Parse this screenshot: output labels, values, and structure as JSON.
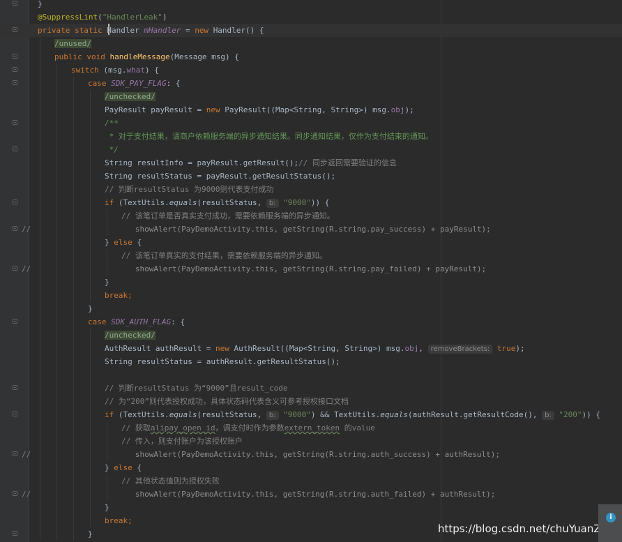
{
  "editor": {
    "lines": [
      {
        "indent": 2,
        "fold": true,
        "tokens": [
          [
            "}",
            ""
          ]
        ]
      },
      {
        "indent": 2,
        "tokens": [
          [
            "@SuppressLint",
            "an"
          ],
          [
            "(",
            ""
          ],
          [
            "\"HandlerLeak\"",
            "str"
          ],
          [
            ")",
            ""
          ]
        ]
      },
      {
        "indent": 2,
        "fold": true,
        "current": true,
        "tokens": [
          [
            "private static ",
            "kw"
          ],
          [
            "Handler ",
            ""
          ],
          [
            "mHandler",
            "fld"
          ],
          [
            " = ",
            ""
          ],
          [
            "new ",
            "kw"
          ],
          [
            "Handler",
            ""
          ],
          [
            "() {",
            ""
          ]
        ]
      },
      {
        "indent": 3,
        "tokens": [
          [
            "/unused/",
            "sup"
          ]
        ]
      },
      {
        "indent": 3,
        "fold": true,
        "tokens": [
          [
            "public void ",
            "kw"
          ],
          [
            "handleMessage",
            "mth"
          ],
          [
            "(Message msg) {",
            ""
          ]
        ]
      },
      {
        "indent": 4,
        "fold": true,
        "tokens": [
          [
            "switch ",
            "kw"
          ],
          [
            "(msg.",
            ""
          ],
          [
            "what",
            "ifld"
          ],
          [
            ") {",
            ""
          ]
        ]
      },
      {
        "indent": 5,
        "fold": true,
        "tokens": [
          [
            "case ",
            "kw"
          ],
          [
            "SDK_PAY_FLAG",
            "fld"
          ],
          [
            ": {",
            ""
          ]
        ]
      },
      {
        "indent": 6,
        "tokens": [
          [
            "/unchecked/",
            "sup"
          ]
        ]
      },
      {
        "indent": 6,
        "tokens": [
          [
            "PayResult payResult = ",
            ""
          ],
          [
            "new ",
            "kw"
          ],
          [
            "PayResult((Map<String, String>) msg.",
            ""
          ],
          [
            "obj",
            "ifld"
          ],
          [
            ");",
            ""
          ]
        ]
      },
      {
        "indent": 6,
        "fold": true,
        "tokens": [
          [
            "/**",
            "dci"
          ]
        ]
      },
      {
        "indent": 6,
        "tokens": [
          [
            " * ",
            "dci"
          ],
          [
            "对于支付结果，请商户依赖服务端的异步通知结果。同步通知结果，仅作为支付结束的通知。",
            "dc"
          ]
        ]
      },
      {
        "indent": 6,
        "fold": true,
        "tokens": [
          [
            " */",
            "dci"
          ]
        ]
      },
      {
        "indent": 6,
        "tokens": [
          [
            "String resultInfo = payResult.getResult();",
            ""
          ],
          [
            "// 同步返回需要验证的信息",
            "cm"
          ]
        ]
      },
      {
        "indent": 6,
        "tokens": [
          [
            "String resultStatus = payResult.getResultStatus();",
            ""
          ]
        ]
      },
      {
        "indent": 6,
        "tokens": [
          [
            "// 判断resultStatus 为9000则代表支付成功",
            "cm"
          ]
        ]
      },
      {
        "indent": 6,
        "fold": true,
        "tokens": [
          [
            "if ",
            "kw"
          ],
          [
            "(TextUtils.",
            ""
          ],
          [
            "equals",
            "ital"
          ],
          [
            "(resultStatus, ",
            ""
          ],
          [
            "b:",
            "hint"
          ],
          [
            " ",
            ""
          ],
          [
            "\"9000\"",
            "str"
          ],
          [
            ")) {",
            ""
          ]
        ]
      },
      {
        "indent": 7,
        "tokens": [
          [
            "// 该笔订单是否真实支付成功，需要依赖服务端的异步通知。",
            "cm"
          ]
        ]
      },
      {
        "indent": 7,
        "fold": true,
        "cmark": "//",
        "tokens": [
          [
            "   showAlert(PayDemoActivity.this, getString(R.string.pay_success) + payResult);",
            "nc"
          ]
        ]
      },
      {
        "indent": 6,
        "tokens": [
          [
            "} ",
            ""
          ],
          [
            "else ",
            "kw"
          ],
          [
            "{",
            ""
          ]
        ]
      },
      {
        "indent": 7,
        "tokens": [
          [
            "// 该笔订单真实的支付结果，需要依赖服务端的异步通知。",
            "cm"
          ]
        ]
      },
      {
        "indent": 7,
        "fold": true,
        "cmark": "//",
        "tokens": [
          [
            "   showAlert(PayDemoActivity.this, getString(R.string.pay_failed) + payResult);",
            "nc"
          ]
        ]
      },
      {
        "indent": 6,
        "tokens": [
          [
            "}",
            ""
          ]
        ]
      },
      {
        "indent": 6,
        "tokens": [
          [
            "break",
            "kw"
          ],
          [
            ";",
            "kw"
          ]
        ]
      },
      {
        "indent": 5,
        "tokens": [
          [
            "}",
            ""
          ]
        ]
      },
      {
        "indent": 5,
        "fold": true,
        "tokens": [
          [
            "case ",
            "kw"
          ],
          [
            "SDK_AUTH_FLAG",
            "fld"
          ],
          [
            ": {",
            ""
          ]
        ]
      },
      {
        "indent": 6,
        "tokens": [
          [
            "/unchecked/",
            "sup"
          ]
        ]
      },
      {
        "indent": 6,
        "tokens": [
          [
            "AuthResult authResult = ",
            ""
          ],
          [
            "new ",
            "kw"
          ],
          [
            "AuthResult((Map<String, String>) msg.",
            ""
          ],
          [
            "obj",
            "ifld"
          ],
          [
            ", ",
            ""
          ],
          [
            "removeBrackets:",
            "hint"
          ],
          [
            " ",
            ""
          ],
          [
            "true",
            "kw"
          ],
          [
            ");",
            ""
          ]
        ]
      },
      {
        "indent": 6,
        "tokens": [
          [
            "String resultStatus = authResult.getResultStatus();",
            ""
          ]
        ]
      },
      {
        "indent": 6,
        "tokens": []
      },
      {
        "indent": 6,
        "fold": true,
        "tokens": [
          [
            "// 判断resultStatus 为“9000”且result_code",
            "cm"
          ]
        ]
      },
      {
        "indent": 6,
        "tokens": [
          [
            "// 为“200”则代表授权成功，具体状态码代表含义可参考授权接口文档",
            "cm"
          ]
        ]
      },
      {
        "indent": 6,
        "fold": true,
        "tokens": [
          [
            "if ",
            "kw"
          ],
          [
            "(TextUtils.",
            ""
          ],
          [
            "equals",
            "ital"
          ],
          [
            "(resultStatus, ",
            ""
          ],
          [
            "b:",
            "hint"
          ],
          [
            " ",
            ""
          ],
          [
            "\"9000\"",
            "str"
          ],
          [
            ") && TextUtils.",
            ""
          ],
          [
            "equals",
            "ital"
          ],
          [
            "(authResult.getResultCode(), ",
            ""
          ],
          [
            "b:",
            "hint"
          ],
          [
            " ",
            ""
          ],
          [
            "\"200\"",
            "str"
          ],
          [
            ")) {",
            ""
          ]
        ]
      },
      {
        "indent": 7,
        "tokens": [
          [
            "// 获取",
            "cm"
          ],
          [
            "alipay_open_id",
            "cm und"
          ],
          [
            "，调支付时作为参数",
            "cm"
          ],
          [
            "extern_token",
            "cm und"
          ],
          [
            " 的value",
            "cm"
          ]
        ]
      },
      {
        "indent": 7,
        "tokens": [
          [
            "// 传入，则支付账户为该授权账户",
            "cm"
          ]
        ]
      },
      {
        "indent": 7,
        "fold": true,
        "cmark": "//",
        "tokens": [
          [
            "   showAlert(PayDemoActivity.this, getString(R.string.auth_success) + authResult);",
            "nc"
          ]
        ]
      },
      {
        "indent": 6,
        "tokens": [
          [
            "} ",
            ""
          ],
          [
            "else ",
            "kw"
          ],
          [
            "{",
            ""
          ]
        ]
      },
      {
        "indent": 7,
        "tokens": [
          [
            "// 其他状态值则为授权失败",
            "cm"
          ]
        ]
      },
      {
        "indent": 7,
        "fold": true,
        "cmark": "//",
        "tokens": [
          [
            "   showAlert(PayDemoActivity.this, getString(R.string.auth_failed) + authResult);",
            "nc"
          ]
        ]
      },
      {
        "indent": 6,
        "tokens": [
          [
            "}",
            ""
          ]
        ]
      },
      {
        "indent": 6,
        "tokens": [
          [
            "break",
            "kw"
          ],
          [
            ";",
            "kw"
          ]
        ]
      },
      {
        "indent": 5,
        "fold": true,
        "tokens": [
          [
            "}",
            ""
          ]
        ]
      }
    ]
  },
  "watermark": "https://blog.csdn.net/chuYuanZhang",
  "notification": {
    "icon": "info-icon",
    "glyph": "i"
  },
  "colors": {
    "background": "#2b2b2b",
    "keyword": "#cc7832",
    "string": "#6a8759",
    "field": "#9876aa",
    "method": "#ffc66d",
    "comment": "#808080",
    "annotation": "#bbb529"
  }
}
